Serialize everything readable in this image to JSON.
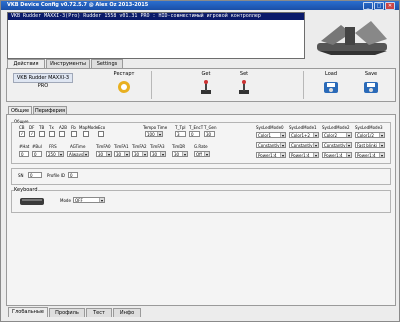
{
  "window": {
    "title": "VKB Device Config v0.72.5.7 @ Alex Oz 2013-2015",
    "min": "_",
    "max": "□",
    "close": "✕"
  },
  "console": {
    "line": "VKB Rudder MAXXI-3(Pro) Rudder 1558  v01.31 PRO   : HID-совместимый игровой контроллер"
  },
  "top_tabs": [
    "Действия",
    "Инструменты",
    "Settings"
  ],
  "device_name": "VKB Rudder MAXXI-3 PRO",
  "actions": {
    "restart": "Рестарт",
    "get": "Get",
    "set": "Set",
    "load": "Load",
    "save": "Save"
  },
  "sub_tabs": [
    "Общие",
    "Периферия"
  ],
  "general": {
    "group_label": "Общие",
    "flags": [
      "CB",
      "DF",
      "TB",
      "Tx",
      "A2B",
      "Fb",
      "MapMode",
      "Eco"
    ],
    "tempo_label": "Tempo Time",
    "tempo_value": "100",
    "ttpl_label": "T_Tpl",
    "tenc_label": "T_EncT",
    "tgen_label": "T_Gen",
    "t_values": [
      "3",
      "0",
      "30"
    ],
    "sys_headers": [
      "SysLedMode0",
      "SysLedMode1",
      "SysLedMode2",
      "SysLedMode3"
    ],
    "sys_row1": [
      "Color1",
      "Color1+2",
      "Color2",
      "Color1/2"
    ],
    "sys_row2": [
      "Constantly",
      "Constantly",
      "Constantly",
      "Fast blinki"
    ],
    "sys_row3": [
      "Power1:4",
      "Power1:4",
      "Power1:4",
      "Power1:4"
    ],
    "row2_labels": [
      "#Hat",
      "#Bul",
      "FRS",
      "AGTime",
      "TimFA0",
      "TimFA1",
      "TimFA2",
      "TimFA3",
      "TimDR",
      "G.Rate"
    ],
    "hat": "0",
    "bul": "0",
    "frs": "250",
    "agtime": "Always",
    "tim_values": [
      "30",
      "30",
      "30",
      "30",
      "30"
    ],
    "grate": "Off"
  },
  "sn": {
    "sn_label": "SN",
    "sn_value": "0",
    "profile_label": "Profile ID",
    "profile_value": "0"
  },
  "keyboard": {
    "label": "Keyboard",
    "mode_label": "Mode",
    "mode_value": "OFF"
  },
  "bottom_tabs": [
    "Глобальные",
    "Профиль",
    "Тест",
    "Инфо"
  ]
}
